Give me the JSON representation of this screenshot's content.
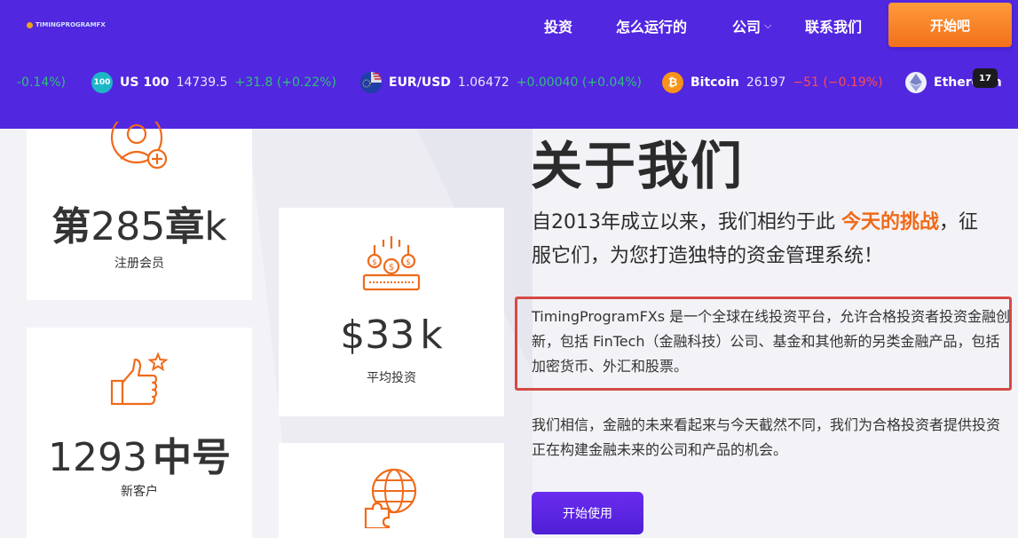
{
  "brand": {
    "logo_text": "TIMINGPROGRAMFX"
  },
  "nav": {
    "items": [
      {
        "label": "投资"
      },
      {
        "label": "怎么运行的"
      },
      {
        "label": "公司",
        "has_dropdown": true
      },
      {
        "label": "联系我们"
      }
    ],
    "cta_label": "开始吧"
  },
  "ticker": [
    {
      "name": "",
      "price": "",
      "change": "-0.14%)",
      "direction": "up"
    },
    {
      "name": "US 100",
      "icon_text": "100",
      "price": "14739.5",
      "change": "+31.8 (+0.22%)",
      "direction": "up"
    },
    {
      "name": "EUR/USD",
      "icon": "eu-us-flag-icon",
      "price": "1.06472",
      "change": "+0.00040 (+0.04%)",
      "direction": "up"
    },
    {
      "name": "Bitcoin",
      "icon_text": "₿",
      "price": "26197",
      "change": "−51 (−0.19%)",
      "direction": "down"
    },
    {
      "name": "Ethereum",
      "icon": "ethereum-icon",
      "price": "",
      "change": "",
      "direction": "up"
    }
  ],
  "tradingview_badge": "17",
  "stats": [
    {
      "value_prefix": "第",
      "value_num": "285",
      "value_suffix": "章",
      "value_unit": "k",
      "label": "注册会员",
      "icon": "user-add-icon"
    },
    {
      "value_prefix": "$",
      "value_num": "33",
      "value_suffix": "",
      "value_unit": "k",
      "label": "平均投资",
      "icon": "money-stack-icon"
    },
    {
      "value_prefix": "",
      "value_num": "1293",
      "value_suffix": "中号",
      "value_unit": "",
      "label": "新客户",
      "icon": "thumbs-up-star-icon"
    },
    {
      "icon": "globe-puzzle-icon"
    }
  ],
  "about": {
    "title": "关于我们",
    "lead_pre": "自2013年成立以来，我们相约于此",
    "lead_highlight": "今天的挑战",
    "lead_post": "，征服它们，为您打造独特的资金管理系统！",
    "paragraph1": "TimingProgramFXs 是一个全球在线投资平台，允许合格投资者投资金融创新，包括 FinTech（金融科技）公司、基金和其他新的另类金融产品，包括加密货币、外汇和股票。",
    "paragraph2": "我们相信，金融的未来看起来与今天截然不同，我们为合格投资者提供投资正在构建金融未来的公司和产品的机会。",
    "cta_label": "开始使用"
  },
  "colors": {
    "header_bg": "#5227e0",
    "accent_orange": "#f06a1a",
    "ticker_up": "#2fc07a",
    "ticker_down": "#ff4d4d",
    "highlight_box": "#d44a44"
  }
}
